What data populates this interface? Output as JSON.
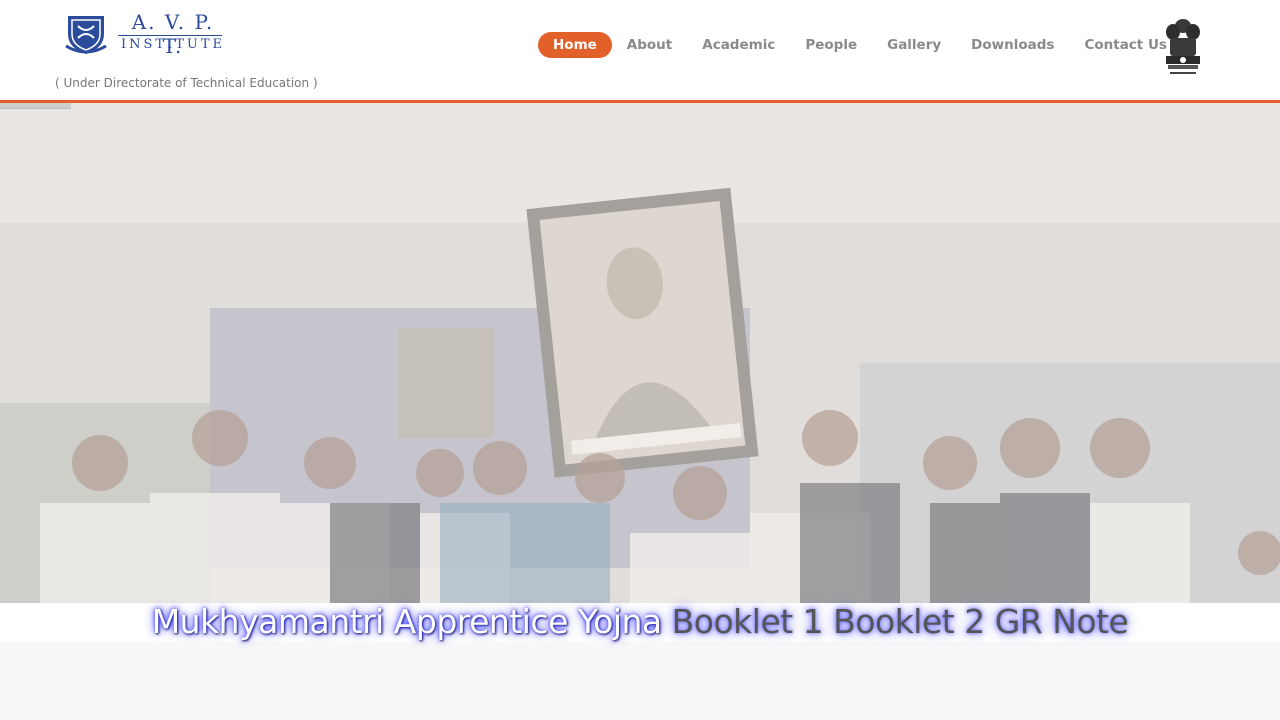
{
  "header": {
    "logo": {
      "line1": "A. V. P. T.",
      "line2": "INSTITUTE"
    },
    "tagline": "( Under Directorate of Technical Education )",
    "nav": [
      {
        "label": "Home",
        "active": true
      },
      {
        "label": "About"
      },
      {
        "label": "Academic"
      },
      {
        "label": "People"
      },
      {
        "label": "Gallery"
      },
      {
        "label": "Downloads"
      },
      {
        "label": "Contact Us"
      }
    ],
    "emblem_icon": "national-emblem-icon"
  },
  "hero": {
    "caption_main": "Mukhyamantri Apprentice Yojna ",
    "links": [
      "Booklet 1",
      "Booklet 2",
      "GR Note"
    ]
  },
  "colors": {
    "accent": "#e2602a",
    "logo_blue": "#2b4c9b",
    "nav_text": "#8a8a8a"
  }
}
